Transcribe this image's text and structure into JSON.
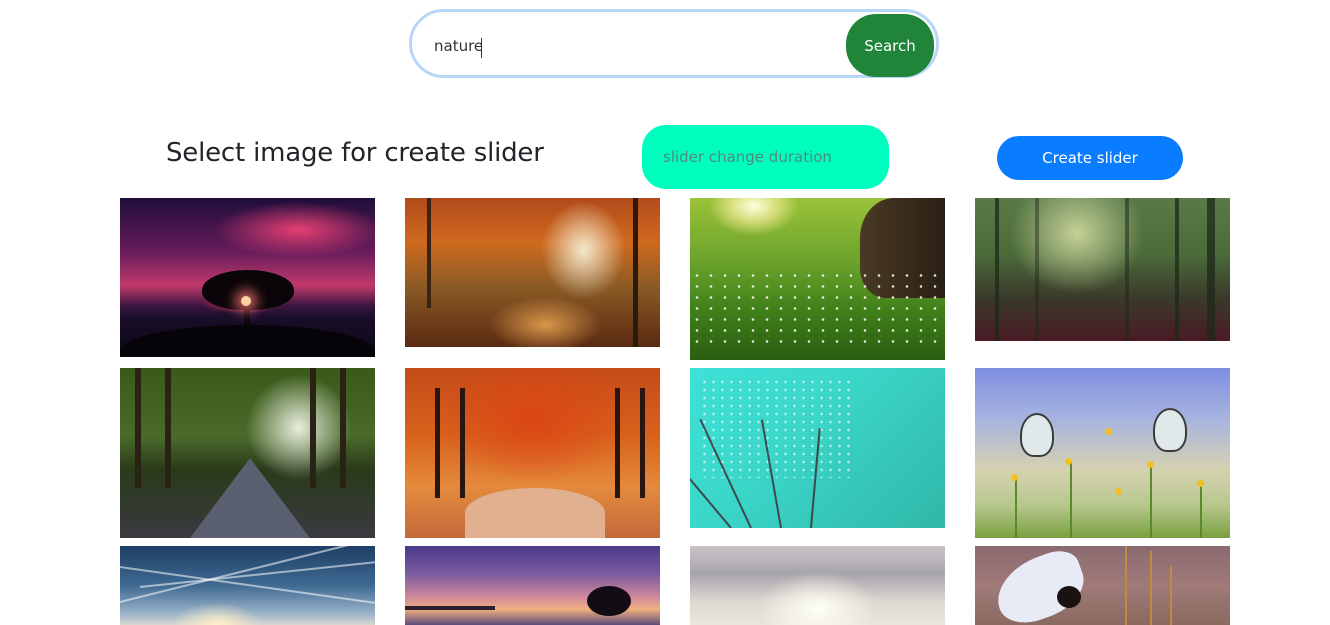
{
  "search": {
    "value": "nature",
    "button_label": "Search"
  },
  "controls": {
    "heading": "Select image for create slider",
    "duration_placeholder": "slider change duration",
    "create_button_label": "Create slider"
  },
  "colors": {
    "search_button": "#208538",
    "create_button": "#0a7cff",
    "duration_field": "#00ffbf",
    "search_border": "#b8d6f7"
  },
  "images": [
    {
      "alt": "tree silhouette at sunset over water with pink clouds"
    },
    {
      "alt": "autumn forest path with orange leaves"
    },
    {
      "alt": "sunlit green meadow with white flowers and tree trunk"
    },
    {
      "alt": "misty green forest"
    },
    {
      "alt": "forest road with sunbeams through trees"
    },
    {
      "alt": "red autumn forest with winding path"
    },
    {
      "alt": "dandelion seeds with water droplets on teal background"
    },
    {
      "alt": "two white butterflies on yellow flowers"
    },
    {
      "alt": "blue sky with contrails and sun"
    },
    {
      "alt": "purple sunset over calm water with lone tree"
    },
    {
      "alt": "bright cloudy sky"
    },
    {
      "alt": "bird flying near dried branches"
    }
  ]
}
